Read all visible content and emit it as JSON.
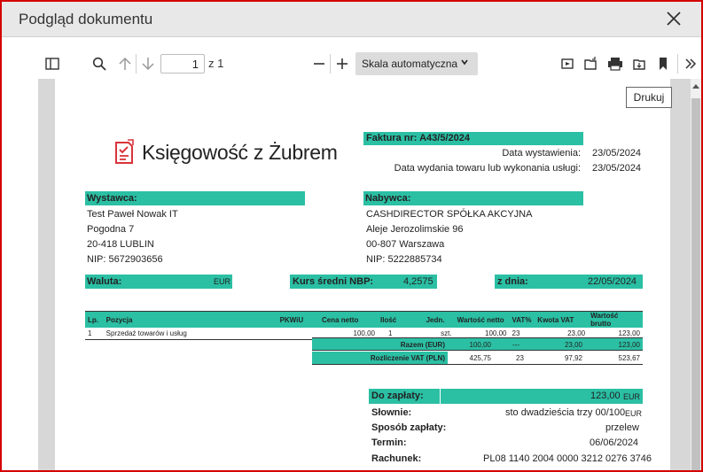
{
  "window": {
    "title": "Podgląd dokumentu"
  },
  "toolbar": {
    "page_current": "1",
    "page_total": "z 1",
    "scale_label": "Skala automatyczna",
    "tooltip": "Drukuj"
  },
  "logo": {
    "text": "Księgowość z Żubrem"
  },
  "invoice": {
    "number_label": "Faktura nr: A43/5/2024",
    "issue_label": "Data wystawienia:",
    "issue_date": "23/05/2024",
    "delivery_label": "Data wydania towaru lub wykonania usługi:",
    "delivery_date": "23/05/2024"
  },
  "seller": {
    "header": "Wystawca:",
    "lines": [
      "Test Paweł Nowak IT",
      "Pogodna 7",
      "20-418 LUBLIN",
      "NIP: 5672903656"
    ]
  },
  "buyer": {
    "header": "Nabywca:",
    "lines": [
      "CASHDIRECTOR SPÓŁKA AKCYJNA",
      "Aleje Jerozolimskie 96",
      "00-807 Warszawa",
      "NIP: 5222885734"
    ]
  },
  "currency": {
    "label": "Waluta:",
    "value": "EUR",
    "nbp_label": "Kurs średni NBP:",
    "nbp_value": "4,2575",
    "date_label": "z dnia:",
    "date_value": "22/05/2024"
  },
  "items": {
    "headers": [
      "Lp.",
      "Pozycja",
      "PKWiU",
      "Cena netto",
      "Ilość",
      "Jedn.",
      "Wartość netto",
      "VAT%",
      "Kwota VAT",
      "Wartość brutto"
    ],
    "rows": [
      [
        "1",
        "Sprzedaż towarów i usług",
        "",
        "100,00",
        "1",
        "szt.",
        "100,00",
        "23",
        "23,00",
        "123,00"
      ]
    ],
    "total_eur": {
      "label": "Razem (EUR)",
      "net": "100,00",
      "vat_rate": "---",
      "vat": "23,00",
      "gross": "123,00"
    },
    "total_pln": {
      "label": "Rozliczenie VAT (PLN)",
      "net": "425,75",
      "vat_rate": "23",
      "vat": "97,92",
      "gross": "523,67"
    }
  },
  "payment": {
    "due_label": "Do zapłaty:",
    "due_value": "123,00",
    "due_currency": "EUR",
    "words_label": "Słownie:",
    "words_value": "sto dwadzieścia trzy 00/100",
    "words_currency": "EUR",
    "method_label": "Sposób zapłaty:",
    "method_value": "przelew",
    "term_label": "Termin:",
    "term_value": "06/06/2024",
    "account_label": "Rachunek:",
    "account_value": "PL08 1140 2004 0000 3212 0276 3746"
  }
}
